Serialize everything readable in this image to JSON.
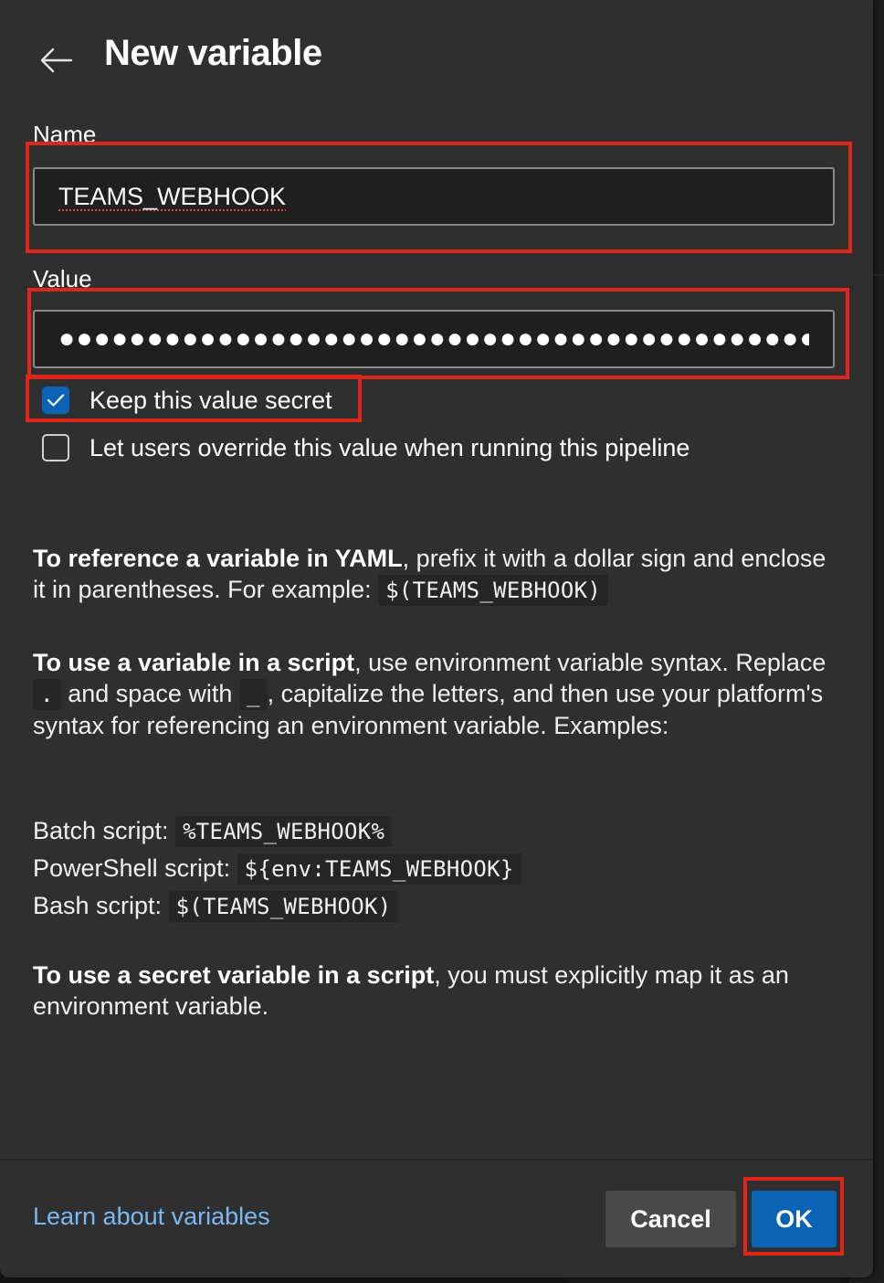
{
  "header": {
    "title": "New variable",
    "back_icon": "arrow-left-icon"
  },
  "name_field": {
    "label": "Name",
    "value": "TEAMS_WEBHOOK"
  },
  "value_field": {
    "label": "Value",
    "masked_value": "●●●●●●●●●●●●●●●●●●●●●●●●●●●●●●●●●●●●●●●●●●●●●●●●"
  },
  "options": {
    "keep_secret": {
      "label": "Keep this value secret",
      "checked": true
    },
    "allow_override": {
      "label": "Let users override this value when running this pipeline",
      "checked": false
    }
  },
  "help": {
    "yaml": {
      "bold": "To reference a variable in YAML",
      "text": ", prefix it with a dollar sign and enclose it in parentheses. For example: ",
      "code": "$(TEAMS_WEBHOOK)"
    },
    "script": {
      "bold": "To use a variable in a script",
      "text1": ", use environment variable syntax. Replace ",
      "code_dot": ".",
      "text2": " and space with ",
      "code_underscore": "_",
      "text3": ", capitalize the letters, and then use your platform's syntax for referencing an environment variable. Examples:"
    },
    "examples": [
      {
        "label": "Batch script: ",
        "code": "%TEAMS_WEBHOOK%"
      },
      {
        "label": "PowerShell script: ",
        "code": "${env:TEAMS_WEBHOOK}"
      },
      {
        "label": "Bash script: ",
        "code": "$(TEAMS_WEBHOOK)"
      }
    ],
    "secret": {
      "bold": "To use a secret variable in a script",
      "text": ", you must explicitly map it as an environment variable."
    }
  },
  "footer": {
    "learn_link": "Learn about variables",
    "cancel_label": "Cancel",
    "ok_label": "OK"
  },
  "colors": {
    "panel": "#2f2f2f",
    "accent": "#0a63b5",
    "link": "#79b8f2",
    "highlight": "#e0261a"
  }
}
